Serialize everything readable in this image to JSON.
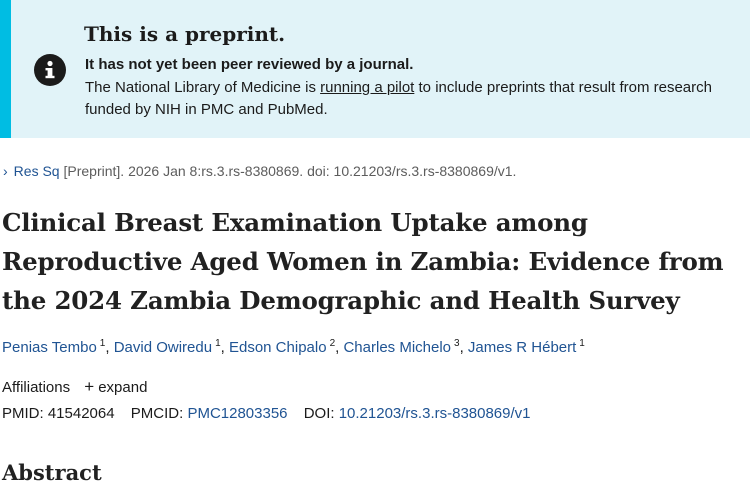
{
  "banner": {
    "icon": "info-circle-icon",
    "title": "This is a preprint.",
    "strong": "It has not yet been peer reviewed by a journal.",
    "text_before": "The National Library of Medicine is ",
    "link": "running a pilot",
    "text_after": " to include preprints that result from research funded by NIH in PMC and PubMed."
  },
  "citation": {
    "chevron": "›",
    "source": "Res Sq",
    "rest": " [Preprint]. 2026 Jan 8:rs.3.rs-8380869. doi: 10.21203/rs.3.rs-8380869/v1."
  },
  "title": "Clinical Breast Examination Uptake among Reproductive Aged Women in Zambia: Evidence from the 2024 Zambia Demographic and Health Survey",
  "authors": [
    {
      "name": "Penias Tembo",
      "sup": "1"
    },
    {
      "name": "David Owiredu",
      "sup": "1"
    },
    {
      "name": "Edson Chipalo",
      "sup": "2"
    },
    {
      "name": "Charles Michelo",
      "sup": "3"
    },
    {
      "name": "James R Hébert",
      "sup": "1"
    }
  ],
  "affiliations": {
    "label": "Affiliations",
    "expand_icon": "+",
    "expand_label": "expand"
  },
  "identifiers": {
    "pmid_label": "PMID:",
    "pmid": "41542064",
    "pmcid_label": "PMCID:",
    "pmcid": "PMC12803356",
    "doi_label": "DOI:",
    "doi": "10.21203/rs.3.rs-8380869/v1"
  },
  "abstract_heading": "Abstract",
  "colors": {
    "banner_bg": "#e1f3f8",
    "banner_accent": "#00bde3",
    "link": "#205493"
  }
}
